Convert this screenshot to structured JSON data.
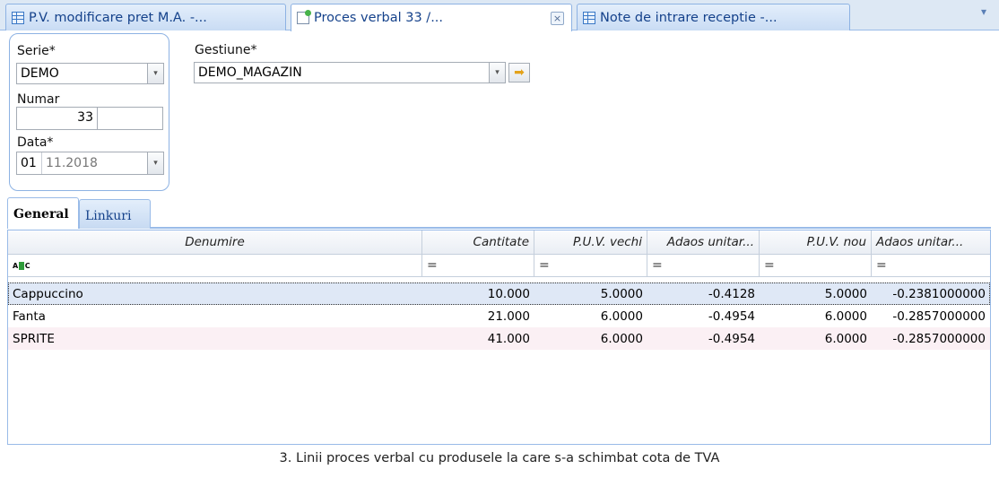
{
  "tabs": [
    {
      "label": "P.V. modificare pret M.A. -...",
      "icon": "grid-icon"
    },
    {
      "label": "Proces verbal 33 /...",
      "icon": "new-document-icon",
      "close": "×"
    },
    {
      "label": "Note de intrare receptie -...",
      "icon": "grid-icon"
    }
  ],
  "tab_menu": "▾",
  "form": {
    "serie_label": "Serie*",
    "serie_value": "DEMO",
    "gestiune_label": "Gestiune*",
    "gestiune_value": "DEMO_MAGAZIN",
    "numar_label": "Numar",
    "numar_value": "33",
    "numar_suffix": "",
    "data_label": "Data*",
    "data_day": "01",
    "data_rest": "11.2018",
    "dropdown_glyph": "▾",
    "go_glyph": "➡"
  },
  "subtabs": {
    "general": "General",
    "linkuri": "Linkuri"
  },
  "grid": {
    "columns": [
      "Denumire",
      "Cantitate",
      "P.U.V. vechi",
      "Adaos unitar...",
      "P.U.V. nou",
      "Adaos unitar..."
    ],
    "filters": [
      "",
      "=",
      "=",
      "=",
      "=",
      "="
    ],
    "rows": [
      [
        "Cappuccino",
        "10.000",
        "5.0000",
        "-0.4128",
        "5.0000",
        "-0.2381000000"
      ],
      [
        "Fanta",
        "21.000",
        "6.0000",
        "-0.4954",
        "6.0000",
        "-0.2857000000"
      ],
      [
        "SPRITE",
        "41.000",
        "6.0000",
        "-0.4954",
        "6.0000",
        "-0.2857000000"
      ]
    ]
  },
  "caption": "3. Linii proces verbal cu produsele la care s-a schimbat cota de TVA",
  "colors": {
    "accent": "#15428b",
    "border": "#99bbe8",
    "selected_row": "#dfe8f6"
  }
}
